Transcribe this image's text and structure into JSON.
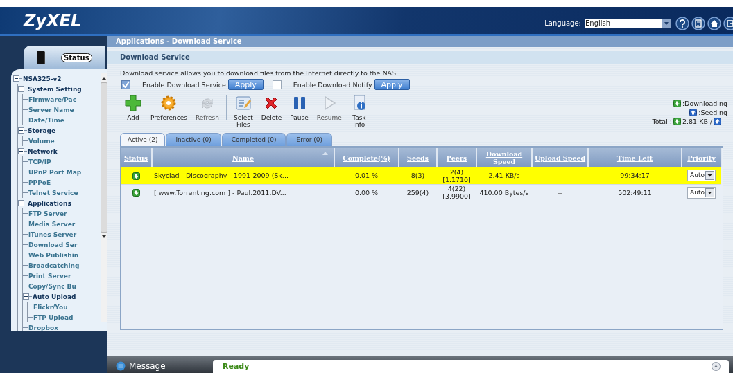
{
  "header": {
    "logo": "ZyXEL",
    "language_label": "Language:",
    "language_value": "English"
  },
  "sidebar": {
    "status_tab": "Status",
    "tree": [
      {
        "label": "NSA325-v2",
        "expanded": true,
        "children": [
          {
            "label": "System Setting",
            "expanded": true,
            "children": [
              {
                "label": "Firmware/Pac"
              },
              {
                "label": "Server Name"
              },
              {
                "label": "Date/Time"
              }
            ]
          },
          {
            "label": "Storage",
            "expanded": true,
            "children": [
              {
                "label": "Volume"
              }
            ]
          },
          {
            "label": "Network",
            "expanded": true,
            "children": [
              {
                "label": "TCP/IP"
              },
              {
                "label": "UPnP Port Map"
              },
              {
                "label": "PPPoE"
              },
              {
                "label": "Telnet Service"
              }
            ]
          },
          {
            "label": "Applications",
            "expanded": true,
            "children": [
              {
                "label": "FTP Server"
              },
              {
                "label": "Media Server"
              },
              {
                "label": "iTunes Server"
              },
              {
                "label": "Download Ser"
              },
              {
                "label": "Web Publishin"
              },
              {
                "label": "Broadcatching"
              },
              {
                "label": "Print Server"
              },
              {
                "label": "Copy/Sync Bu"
              },
              {
                "label": "Auto Upload",
                "expanded": true,
                "children": [
                  {
                    "label": "Flickr/You"
                  },
                  {
                    "label": "FTP Upload"
                  }
                ]
              },
              {
                "label": "Dropbox"
              }
            ]
          }
        ]
      }
    ]
  },
  "breadcrumb": "Applications - Download Service",
  "section_title": "Download Service",
  "description": "Download service allows you to download files from the Internet directly to the NAS.",
  "options": [
    {
      "label": "Enable Download Service",
      "checked": true,
      "button": "Apply"
    },
    {
      "label": "Enable Download Notify",
      "checked": false,
      "button": "Apply"
    }
  ],
  "toolbar": [
    {
      "label": "Add",
      "disabled": false
    },
    {
      "label": "Preferences",
      "disabled": false
    },
    {
      "label": "Refresh",
      "disabled": true
    },
    {
      "label": "Select Files",
      "disabled": false
    },
    {
      "label": "Delete",
      "disabled": false
    },
    {
      "label": "Pause",
      "disabled": false
    },
    {
      "label": "Resume",
      "disabled": true
    },
    {
      "label": "Task Info",
      "disabled": false
    }
  ],
  "legend": [
    {
      "kind": "downloading",
      "label": ":Downloading"
    },
    {
      "kind": "seeding",
      "label": ":Seeding"
    }
  ],
  "total": {
    "label": "Total :",
    "download": "2.81 KB /",
    "upload": "--"
  },
  "tabs": [
    {
      "label": "Active (2)",
      "selected": true
    },
    {
      "label": "Inactive (0)",
      "selected": false
    },
    {
      "label": "Completed (0)",
      "selected": false
    },
    {
      "label": "Error (0)",
      "selected": false
    }
  ],
  "table": {
    "columns": [
      "Status",
      "Name",
      "Complete(%)",
      "Seeds",
      "Peers",
      "Download Speed",
      "Upload Speed",
      "Time Left",
      "Priority"
    ],
    "rows": [
      {
        "kind": "downloading",
        "selected": true,
        "name": "Skyclad - Discography - 1991-2009 (Sk...",
        "complete": "0.01 %",
        "seeds": "8(3)",
        "peers": "2(4)",
        "ratio": "[1.1710]",
        "download": "2.41 KB/s",
        "upload": "--",
        "time_left": "99:34:17",
        "priority": "Auto"
      },
      {
        "kind": "downloading",
        "selected": false,
        "name": "[ www.Torrenting.com ] - Paul.2011.DV...",
        "complete": "0.00 %",
        "seeds": "259(4)",
        "peers": "4(22)",
        "ratio": "[3.9900]",
        "download": "410.00 Bytes/s",
        "upload": "--",
        "time_left": "502:49:11",
        "priority": "Auto"
      }
    ]
  },
  "message_bar": {
    "label": "Message",
    "status": "Ready"
  }
}
